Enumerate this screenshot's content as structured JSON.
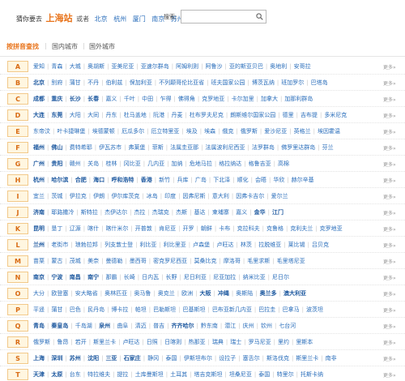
{
  "header": {
    "guess_prefix": "猜你要去",
    "main_city": "上海站",
    "or_label": "或者",
    "alt_cities": [
      "北京",
      "杭州",
      "厦门",
      "南京",
      "苏州"
    ],
    "search_label": "搜索:",
    "search_value": "",
    "search_icon": "search-icon"
  },
  "tabs": [
    {
      "label": "按拼音查找",
      "active": true
    },
    {
      "label": "国内城市",
      "active": false
    },
    {
      "label": "国外城市",
      "active": false
    }
  ],
  "more_label": "更多»",
  "rows": [
    {
      "letter": "A",
      "cities": [
        "爱知",
        "青森",
        "大城",
        "奥胡斯",
        "亚美尼亚",
        "亚速尔群岛",
        "阿姆利则",
        "阿鲁沙",
        "亚的斯亚贝巴",
        "奥地利",
        "安哥拉"
      ],
      "bold": []
    },
    {
      "letter": "B",
      "cities": [
        "北京",
        "别府",
        "蒲甘",
        "不丹",
        "伯利兹",
        "保加利亚",
        "不列颠哥伦比亚省",
        "班夫国家公园",
        "博茨瓦纳",
        "班加罗尔",
        "巴塔岛"
      ],
      "bold": [
        "北京"
      ]
    },
    {
      "letter": "C",
      "cities": [
        "成都",
        "重庆",
        "长沙",
        "长春",
        "嘉义",
        "千叶",
        "中田",
        "乍得",
        "佛得角",
        "克罗地亚",
        "卡尔加里",
        "加拿大",
        "加那利群岛"
      ],
      "bold": [
        "成都",
        "重庆",
        "长沙",
        "长春"
      ]
    },
    {
      "letter": "D",
      "cities": [
        "大连",
        "东莞",
        "大阳",
        "大同",
        "丹东",
        "杜马盖地",
        "阮港",
        "丹麦",
        "杜布罗夫尼克",
        "朗斯维尔国家公园",
        "德里",
        "吉布提",
        "多米尼克"
      ],
      "bold": [
        "大连",
        "东莞"
      ]
    },
    {
      "letter": "E",
      "cities": [
        "东帝汶",
        "叶卡捷琳堡",
        "埃德蒙顿",
        "厄瓜多尔",
        "厄立特里亚",
        "埃及",
        "埃森",
        "俄克",
        "俄罗斯",
        "爱沙尼亚",
        "英格兰",
        "埃因霍温"
      ],
      "bold": []
    },
    {
      "letter": "F",
      "cities": [
        "福州",
        "佛山",
        "费特希耶",
        "伊瓦苏市",
        "弗莱堡",
        "菲斯",
        "法属圭亚那",
        "法属波利尼西亚",
        "法罗群岛",
        "佛罗里达群岛",
        "芬兰"
      ],
      "bold": [
        "福州",
        "佛山"
      ]
    },
    {
      "letter": "G",
      "cities": [
        "广州",
        "贵阳",
        "赣州",
        "关岛",
        "桂林",
        "冈比亚",
        "几内亚",
        "加纳",
        "危地马拉",
        "格拉纳达",
        "格鲁吉亚",
        "高棉"
      ],
      "bold": [
        "广州",
        "贵阳"
      ]
    },
    {
      "letter": "H",
      "cities": [
        "杭州",
        "哈尔滨",
        "合肥",
        "海口",
        "呼和浩特",
        "香港",
        "新竹",
        "兵库",
        "广岛",
        "下北泽",
        "顺化",
        "会晤",
        "华欣",
        "赫尔辛基"
      ],
      "bold": [
        "杭州",
        "哈尔滨",
        "合肥",
        "海口",
        "呼和浩特",
        "香港"
      ]
    },
    {
      "letter": "I",
      "cities": [
        "宜兰",
        "茨城",
        "伊拉克",
        "伊朗",
        "伊尔库茨克",
        "冰岛",
        "印度",
        "因弗尼斯",
        "意大利",
        "因弗卡吉尔",
        "爱尔兰"
      ],
      "bold": []
    },
    {
      "letter": "J",
      "cities": [
        "济南",
        "耶路撒冷",
        "斯特拉",
        "杰伊达尔",
        "杰拉",
        "杰瑞克",
        "杰斯",
        "基达",
        "柬埔寨",
        "嘉义",
        "金华",
        "江门"
      ],
      "bold": [
        "济南",
        "金华",
        "江门"
      ]
    },
    {
      "letter": "K",
      "cities": [
        "昆明",
        "垦丁",
        "辽源",
        "喀什",
        "喀什米尔",
        "开普敦",
        "肯尼亚",
        "开罗",
        "朝鲜",
        "卡布",
        "克拉科夫",
        "克鲁格",
        "克利夫兰",
        "克罗地亚"
      ],
      "bold": [
        "昆明"
      ]
    },
    {
      "letter": "L",
      "cities": [
        "兰州",
        "老街市",
        "琅勃拉邦",
        "列支敦士登",
        "利比亚",
        "利比里亚",
        "卢森堡",
        "卢旺达",
        "林茨",
        "拉脱维亚",
        "莱比锡",
        "吕贝克"
      ],
      "bold": [
        "兰州"
      ]
    },
    {
      "letter": "M",
      "cities": [
        "苗栗",
        "蒙古",
        "茂城",
        "美奈",
        "曼德勒",
        "墨西哥",
        "密克罗尼西亚",
        "莫桑比克",
        "摩洛哥",
        "毛里求斯",
        "毛里塔尼亚"
      ],
      "bold": []
    },
    {
      "letter": "N",
      "cities": [
        "南京",
        "宁波",
        "南昌",
        "南宁",
        "那霸",
        "长崎",
        "日内瓦",
        "长野",
        "尼日利亚",
        "尼亚加拉",
        "纳米比亚",
        "尼日尔"
      ],
      "bold": [
        "南京",
        "宁波",
        "南昌",
        "南宁"
      ]
    },
    {
      "letter": "O",
      "cities": [
        "大分",
        "欧登塞",
        "安大略省",
        "奥林匹亚",
        "奥马鲁",
        "奥克兰",
        "欧洲",
        "大阪",
        "冲绳",
        "奥斯陆",
        "奥兰多",
        "澳大利亚"
      ],
      "bold": [
        "大阪",
        "冲绳",
        "奥兰多",
        "澳大利亚"
      ]
    },
    {
      "letter": "P",
      "cities": [
        "平遥",
        "蒲甘",
        "巴色",
        "民丹岛",
        "博卡拉",
        "帕坦",
        "巴勒斯坦",
        "巴基斯坦",
        "巴布亚新几内亚",
        "巴拉圭",
        "巴拿马",
        "波茨坦"
      ],
      "bold": []
    },
    {
      "letter": "Q",
      "cities": [
        "青岛",
        "秦皇岛",
        "千岛湖",
        "泉州",
        "曲阜",
        "清迈",
        "普吉",
        "齐齐哈尔",
        "黔东南",
        "潜江",
        "庆州",
        "钦州",
        "七台河"
      ],
      "bold": [
        "青岛",
        "秦皇岛",
        "泉州",
        "齐齐哈尔"
      ]
    },
    {
      "letter": "R",
      "cities": [
        "俄罗斯",
        "鲁昂",
        "若开",
        "斯里兰卡",
        "卢旺达",
        "日照",
        "日喀则",
        "热那亚",
        "瑞典",
        "瑞士",
        "罗马尼亚",
        "里约",
        "里斯本"
      ],
      "bold": []
    },
    {
      "letter": "S",
      "cities": [
        "上海",
        "深圳",
        "苏州",
        "沈阳",
        "三亚",
        "石家庄",
        "静冈",
        "泰国",
        "伊斯坦布尔",
        "设拉子",
        "塞舌尔",
        "斯洛伐克",
        "斯里兰卡",
        "南非"
      ],
      "bold": [
        "上海",
        "深圳",
        "苏州",
        "沈阳",
        "三亚",
        "石家庄"
      ]
    },
    {
      "letter": "T",
      "cities": [
        "天津",
        "太原",
        "台东",
        "特拉维夫",
        "提拉",
        "土库曼斯坦",
        "土耳其",
        "塔吉克斯坦",
        "坦桑尼亚",
        "泰国",
        "特里尔",
        "托斯卡纳"
      ],
      "bold": [
        "天津",
        "太原"
      ]
    }
  ]
}
